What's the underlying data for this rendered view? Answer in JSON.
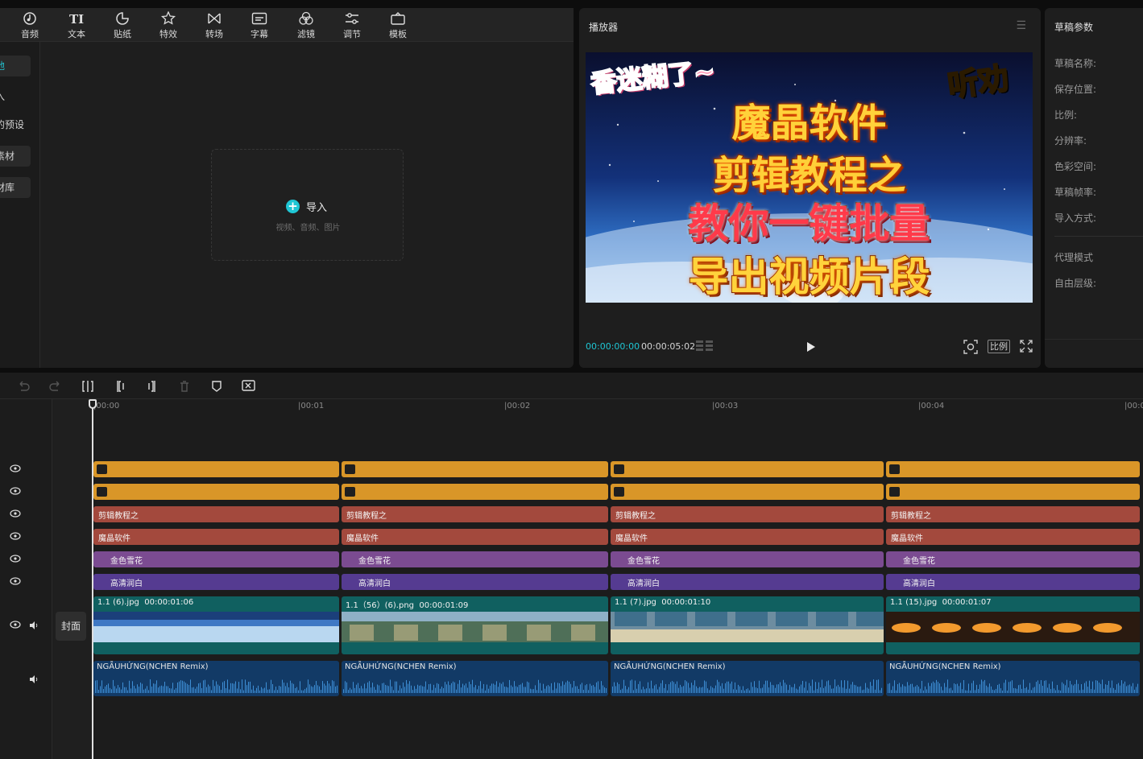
{
  "toolbar": {
    "items": [
      {
        "label": "音频",
        "icon": "audio-icon"
      },
      {
        "label": "文本",
        "icon": "text-icon"
      },
      {
        "label": "贴纸",
        "icon": "sticker-icon"
      },
      {
        "label": "特效",
        "icon": "effects-icon"
      },
      {
        "label": "转场",
        "icon": "transition-icon"
      },
      {
        "label": "字幕",
        "icon": "subtitle-icon"
      },
      {
        "label": "滤镜",
        "icon": "filter-icon"
      },
      {
        "label": "调节",
        "icon": "adjust-icon"
      },
      {
        "label": "模板",
        "icon": "template-icon"
      }
    ]
  },
  "sidebar": {
    "items": [
      {
        "label": "地"
      },
      {
        "label": "入"
      },
      {
        "label": "的预设"
      },
      {
        "label": "素材"
      },
      {
        "label": "材库"
      }
    ]
  },
  "media": {
    "import_label": "导入",
    "import_hint": "视频、音频、图片"
  },
  "player": {
    "title": "播放器",
    "current_time": "00:00:00:00",
    "duration": "00:00:05:02",
    "ratio_label": "比例",
    "preview_text": {
      "corner": "香迷糊了~",
      "side": "听劝",
      "line1": "魔晶软件",
      "line2": "剪辑教程之",
      "line3": "教你一键批量",
      "line4": "导出视频片段"
    }
  },
  "properties": {
    "title": "草稿参数",
    "fields": [
      "草稿名称:",
      "保存位置:",
      "比例:",
      "分辨率:",
      "色彩空间:",
      "草稿帧率:",
      "导入方式:",
      "代理模式",
      "自由层级:"
    ]
  },
  "timeline": {
    "ruler": [
      "|00:00",
      "|00:01",
      "|00:02",
      "|00:03",
      "|00:04",
      "|00:0"
    ],
    "cover_label": "封面",
    "text_track_1": [
      "剪辑教程之",
      "剪辑教程之",
      "剪辑教程之",
      "剪辑教程之"
    ],
    "text_track_2": [
      "魔晶软件",
      "魔晶软件",
      "魔晶软件",
      "魔晶软件"
    ],
    "effect_track": [
      "金色雪花",
      "金色雪花",
      "金色雪花",
      "金色雪花"
    ],
    "filter_track": [
      "高清润白",
      "高清润白",
      "高清润白",
      "高清润白"
    ],
    "video_clips": [
      {
        "name": "1.1 (6).jpg",
        "duration": "00:00:01:06"
      },
      {
        "name": "1.1（56）(6).png",
        "duration": "00:00:01:09"
      },
      {
        "name": "1.1 (7).jpg",
        "duration": "00:00:01:10"
      },
      {
        "name": "1.1 (15).jpg",
        "duration": "00:00:01:07"
      }
    ],
    "audio_clips": [
      "NGẪUHỨNG(NCHEN Remix)",
      "NGẪUHỨNG(NCHEN Remix)",
      "NGẪUHỨNG(NCHEN Remix)",
      "NGẪUHỨNG(NCHEN Remix)"
    ]
  },
  "colors": {
    "accent": "#1fc6d4",
    "sticker": "#d99628",
    "text": "#a3493d",
    "effect": "#7b4b91",
    "filter": "#553b91",
    "video": "#106060",
    "audio": "#123a66"
  }
}
